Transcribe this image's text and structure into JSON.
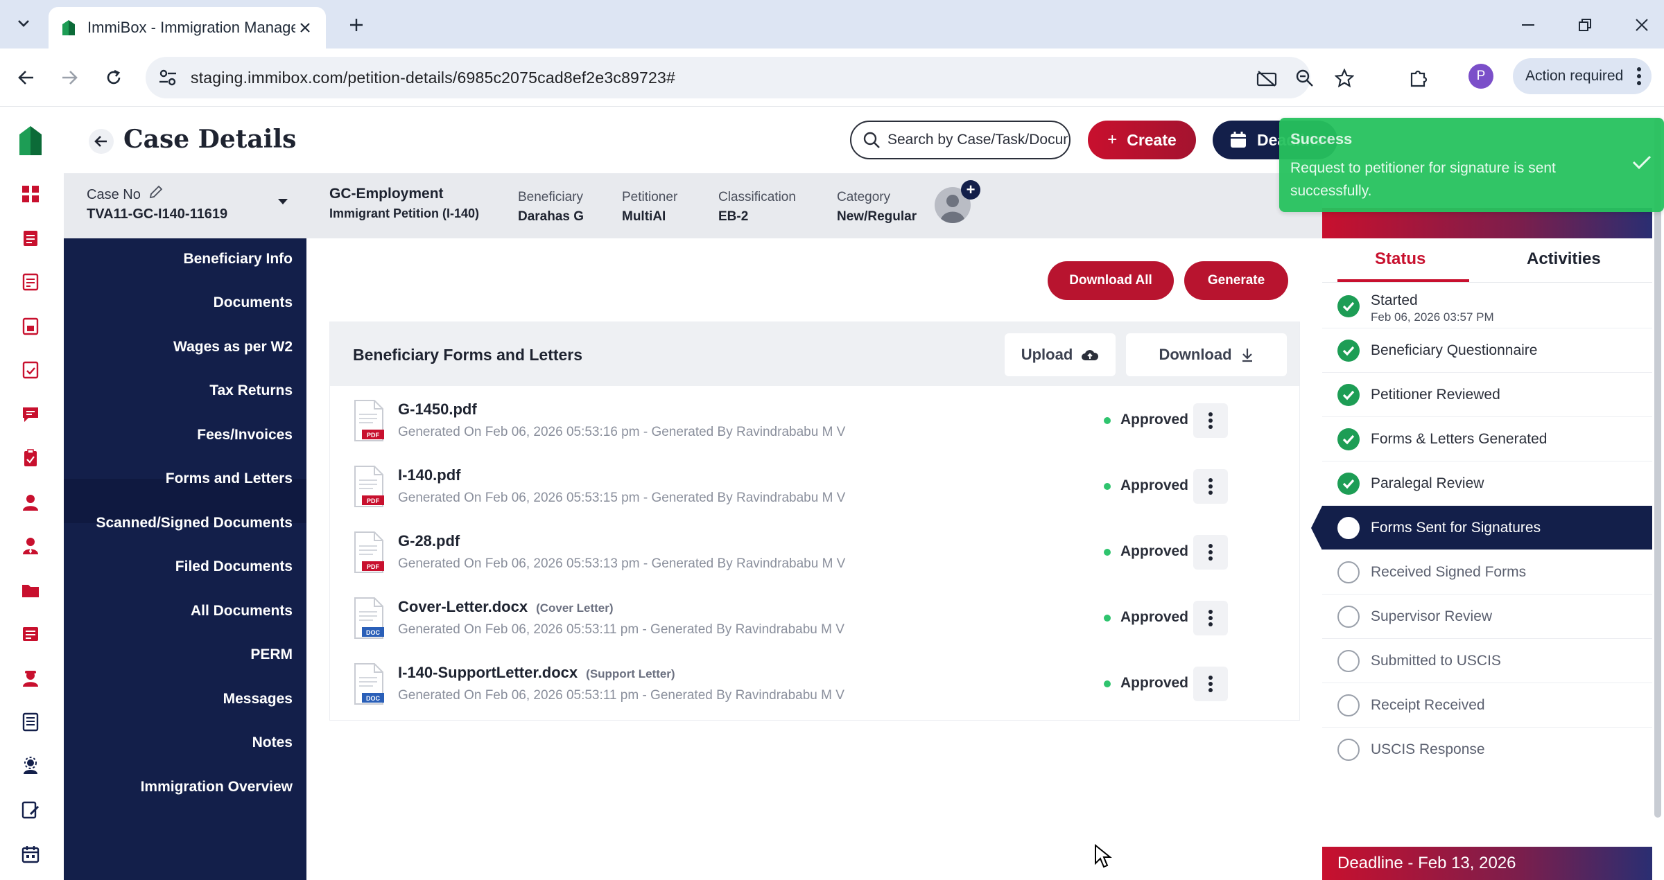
{
  "browser": {
    "tab_title": "ImmiBox - Immigration Manage",
    "url": "staging.immibox.com/petition-details/6985c2075cad8ef2e3c89723#",
    "profile_initial": "P",
    "action_required": "Action required"
  },
  "header": {
    "title": "Case Details",
    "search_placeholder": "Search by Case/Task/Document",
    "create_label": "Create",
    "deadline_label": "Deadline"
  },
  "case": {
    "case_no_label": "Case No",
    "case_no": "TVA11-GC-I140-11619",
    "type": "GC-Employment",
    "subtype": "Immigrant Petition (I-140)",
    "beneficiary_label": "Beneficiary",
    "beneficiary": "Darahas G",
    "petitioner_label": "Petitioner",
    "petitioner": "MultiAI",
    "classification_label": "Classification",
    "classification": "EB-2",
    "category_label": "Category",
    "category": "New/Regular"
  },
  "left_nav": {
    "items": [
      "Beneficiary Info",
      "Documents",
      "Wages as per W2",
      "Tax Returns",
      "Fees/Invoices",
      "Forms and Letters",
      "Scanned/Signed Documents",
      "Filed Documents",
      "All Documents",
      "PERM",
      "Messages",
      "Notes",
      "Immigration Overview"
    ],
    "active": "Forms and Letters"
  },
  "main": {
    "download_all": "Download All",
    "generate": "Generate",
    "panel_title": "Beneficiary Forms and Letters",
    "upload": "Upload",
    "download": "Download",
    "documents": [
      {
        "name": "G-1450.pdf",
        "tag": "",
        "kind": "PDF",
        "meta": "Generated On Feb 06, 2026 05:53:16 pm - Generated By Ravindrababu M V",
        "status": "Approved"
      },
      {
        "name": "I-140.pdf",
        "tag": "",
        "kind": "PDF",
        "meta": "Generated On Feb 06, 2026 05:53:15 pm - Generated By Ravindrababu M V",
        "status": "Approved"
      },
      {
        "name": "G-28.pdf",
        "tag": "",
        "kind": "PDF",
        "meta": "Generated On Feb 06, 2026 05:53:13 pm - Generated By Ravindrababu M V",
        "status": "Approved"
      },
      {
        "name": "Cover-Letter.docx",
        "tag": "(Cover Letter)",
        "kind": "DOC",
        "meta": "Generated On Feb 06, 2026 05:53:11 pm - Generated By Ravindrababu M V",
        "status": "Approved"
      },
      {
        "name": "I-140-SupportLetter.docx",
        "tag": "(Support Letter)",
        "kind": "DOC",
        "meta": "Generated On Feb 06, 2026 05:53:11 pm - Generated By Ravindrababu M V",
        "status": "Approved"
      }
    ]
  },
  "status_panel": {
    "tab_status": "Status",
    "tab_activities": "Activities",
    "steps": [
      {
        "label": "Started",
        "sub": "Feb 06, 2026 03:57 PM",
        "state": "done"
      },
      {
        "label": "Beneficiary Questionnaire",
        "sub": "",
        "state": "done"
      },
      {
        "label": "Petitioner Reviewed",
        "sub": "",
        "state": "done"
      },
      {
        "label": "Forms & Letters Generated",
        "sub": "",
        "state": "done"
      },
      {
        "label": "Paralegal Review",
        "sub": "",
        "state": "done"
      },
      {
        "label": "Forms Sent for Signatures",
        "sub": "",
        "state": "current"
      },
      {
        "label": "Received Signed Forms",
        "sub": "",
        "state": "todo"
      },
      {
        "label": "Supervisor Review",
        "sub": "",
        "state": "todo"
      },
      {
        "label": "Submitted to USCIS",
        "sub": "",
        "state": "todo"
      },
      {
        "label": "Receipt Received",
        "sub": "",
        "state": "todo"
      },
      {
        "label": "USCIS Response",
        "sub": "",
        "state": "todo"
      }
    ],
    "deadline": "Deadline - Feb 13, 2026"
  },
  "toast": {
    "title": "Success",
    "message": "Request to petitioner for signature is sent successfully."
  },
  "colors": {
    "brand_red": "#c8102e",
    "navy": "#131f4a",
    "success": "#1d9d55",
    "toast_green": "#27c25e"
  }
}
